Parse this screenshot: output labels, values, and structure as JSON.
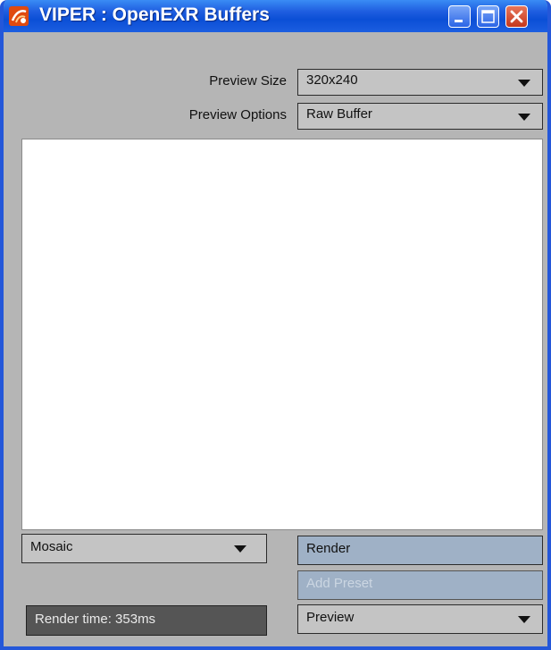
{
  "window": {
    "title": "VIPER : OpenEXR Buffers",
    "app_icon": "viper-icon",
    "controls": [
      "minimize-icon",
      "maximize-icon",
      "close-icon"
    ]
  },
  "preview_size": {
    "label": "Preview Size",
    "value": "320x240"
  },
  "preview_options": {
    "label": "Preview Options",
    "value": "Raw Buffer"
  },
  "mode_dropdown": {
    "value": "Mosaic"
  },
  "buttons": {
    "render": "Render",
    "add_preset": "Add Preset"
  },
  "status": {
    "render_time": "Render time: 353ms"
  },
  "preset_dropdown": {
    "value": "Preview"
  },
  "colors": {
    "window_border": "#2457d9",
    "panel_bg": "#b5b5b5",
    "button_blue": "#9fb1c6",
    "close_red": "#c4371c"
  }
}
